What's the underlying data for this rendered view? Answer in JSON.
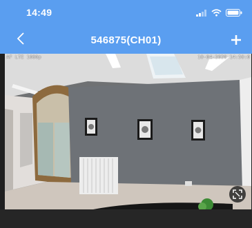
{
  "status_bar": {
    "time": "14:49"
  },
  "nav": {
    "title": "546875(CH01)"
  },
  "video": {
    "osd_left": "AF LTE 1080p",
    "osd_right": "10-04-2020 14:50:0"
  },
  "icons": {
    "back": "back-chevron-icon",
    "add": "plus-icon",
    "fullscreen": "fullscreen-icon",
    "signal": "signal-icon",
    "wifi": "wifi-icon",
    "battery": "battery-icon"
  },
  "colors": {
    "accent": "#5a9ef0"
  }
}
